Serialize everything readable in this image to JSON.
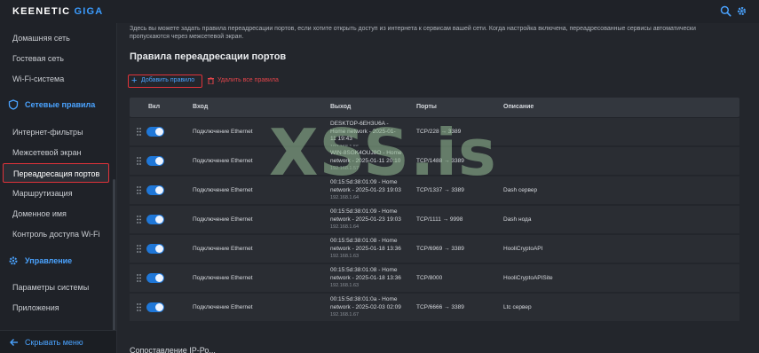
{
  "header": {
    "logo_main": "KEENETIC",
    "logo_model": "GIGA",
    "search_icon": "search-icon",
    "settings_icon": "gear-icon"
  },
  "sidebar": {
    "items": [
      {
        "label": "Домашняя сеть"
      },
      {
        "label": "Гостевая сеть"
      },
      {
        "label": "Wi-Fi-система"
      }
    ],
    "section_network": {
      "label": "Сетевые правила",
      "icon": "shield-icon"
    },
    "network_items": [
      {
        "label": "Интернет-фильтры"
      },
      {
        "label": "Межсетевой экран"
      },
      {
        "label": "Переадресация портов",
        "active": true
      },
      {
        "label": "Маршрутизация"
      },
      {
        "label": "Доменное имя"
      },
      {
        "label": "Контроль доступа Wi-Fi"
      }
    ],
    "section_manage": {
      "label": "Управление",
      "icon": "gear-icon"
    },
    "manage_items": [
      {
        "label": "Параметры системы"
      },
      {
        "label": "Приложения"
      }
    ],
    "collapse_label": "Скрывать меню"
  },
  "main": {
    "intro": "Здесь вы можете задать правила переадресации портов, если хотите открыть доступ из интернета к сервисам вашей сети. Когда настройка включена, переадресованные сервисы автоматически пропускаются через межсетевой экран.",
    "title": "Правила переадресации портов",
    "add_button": "Добавить правило",
    "delete_all": "Удалить все правила",
    "columns": {
      "enabled": "Вкл",
      "entry": "Вход",
      "exit": "Выход",
      "ports": "Порты",
      "description": "Описание"
    },
    "rows": [
      {
        "entry": "Подключение Ethernet",
        "exit_line1": "DESKTOP-6EH3U6A -",
        "exit_line2": "Home network - 2025-01-",
        "exit_line3": "11 19:43",
        "exit_ip": "192.168.1.56",
        "ports": "TCP/228 → 3389",
        "description": "",
        "enabled": true
      },
      {
        "entry": "Подключение Ethernet",
        "exit_line1": "WIN-8SGK4OUJ8O - Home",
        "exit_line2": "network - 2025-01-11 20:10",
        "exit_line3": "",
        "exit_ip": "192.168.1.57",
        "ports": "TCP/1488 → 3389",
        "description": "",
        "enabled": true
      },
      {
        "entry": "Подключение Ethernet",
        "exit_line1": "00:15:5d:38:01:09 - Home",
        "exit_line2": "network - 2025-01-23 19:03",
        "exit_line3": "",
        "exit_ip": "192.168.1.64",
        "ports": "TCP/1337 → 3389",
        "description": "Dash сервер",
        "enabled": true
      },
      {
        "entry": "Подключение Ethernet",
        "exit_line1": "00:15:5d:38:01:09 - Home",
        "exit_line2": "network - 2025-01-23 19:03",
        "exit_line3": "",
        "exit_ip": "192.168.1.64",
        "ports": "TCP/1111 → 9998",
        "description": "Dash нода",
        "enabled": true
      },
      {
        "entry": "Подключение Ethernet",
        "exit_line1": "00:15:5d:38:01:08 - Home",
        "exit_line2": "network - 2025-01-18 13:36",
        "exit_line3": "",
        "exit_ip": "192.168.1.63",
        "ports": "TCP/6969 → 3389",
        "description": "HooliCryptoAPI",
        "enabled": true
      },
      {
        "entry": "Подключение Ethernet",
        "exit_line1": "00:15:5d:38:01:08 - Home",
        "exit_line2": "network - 2025-01-18 13:36",
        "exit_line3": "",
        "exit_ip": "192.168.1.63",
        "ports": "TCP/8000",
        "description": "HooliCryptoAPISite",
        "enabled": true
      },
      {
        "entry": "Подключение Ethernet",
        "exit_line1": "00:15:5d:38:01:0a - Home",
        "exit_line2": "network - 2025-02-03 02:09",
        "exit_line3": "",
        "exit_ip": "192.168.1.67",
        "ports": "TCP/6666 → 3389",
        "description": "Ltc сервер",
        "enabled": true
      }
    ],
    "bottom_hint": "Сопоставление IP-Ро..."
  },
  "watermark": "XSS.is",
  "colors": {
    "accent": "#3b9cff",
    "highlight_border": "#e0333a",
    "toggle_on": "#1f77d8"
  }
}
